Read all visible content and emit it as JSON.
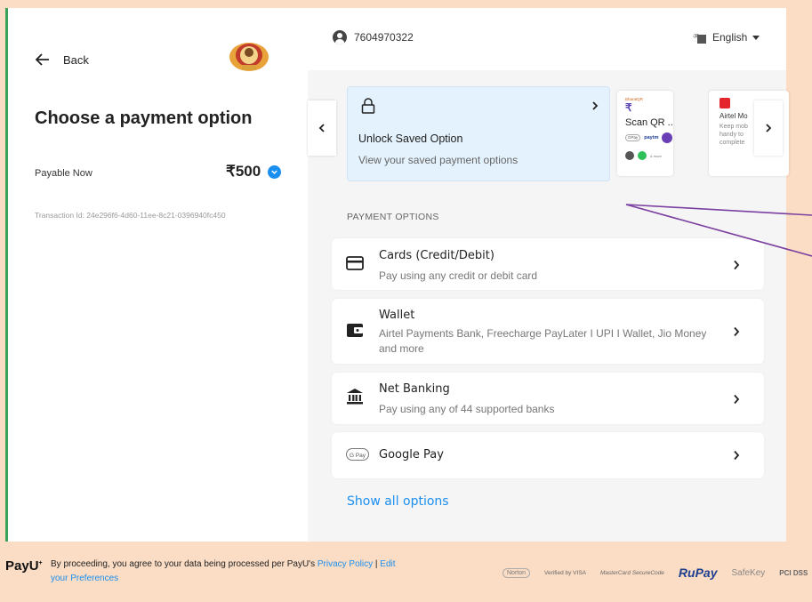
{
  "left": {
    "back_label": "Back",
    "title": "Choose a payment option",
    "payable_label": "Payable Now",
    "payable_amount": "₹500",
    "transaction": "Transaction Id: 24e296f6-4d60-11ee-8c21-0396940fc450"
  },
  "header": {
    "phone": "7604970322",
    "language": "English"
  },
  "saved": {
    "title": "Unlock Saved Option",
    "subtitle": "View your saved payment options"
  },
  "qr_card": {
    "tag": "BharatQR",
    "title": "Scan QR ...",
    "pill_label": "GPay",
    "paytm_label": "paytm",
    "extra_label": "& more"
  },
  "airtel_card": {
    "title": "Airtel Mo",
    "description": "Keep mob\nhandy to\ncomplete"
  },
  "section_label": "PAYMENT OPTIONS",
  "options": [
    {
      "title": "Cards (Credit/Debit)",
      "desc": "Pay using any credit or debit card",
      "icon": "card-icon"
    },
    {
      "title": "Wallet",
      "desc": "Airtel Payments Bank, Freecharge PayLater I UPI I Wallet, Jio Money and more",
      "icon": "wallet-icon"
    },
    {
      "title": "Net Banking",
      "desc": "Pay using any of 44 supported banks",
      "icon": "bank-icon"
    },
    {
      "title": "Google Pay",
      "desc": "",
      "icon": "gpay-icon",
      "gpay_badge": "G Pay"
    }
  ],
  "show_all": "Show all options",
  "footer": {
    "brand": "PayU",
    "text": "By proceeding, you agree to your data being processed per PayU's ",
    "privacy": "Privacy Policy",
    "separator": " | ",
    "prefs": "Edit your Preferences"
  },
  "badges": {
    "norton": "Norton",
    "visa": "Verified by VISA",
    "mastercard": "MasterCard SecureCode",
    "rupay": "RuPay",
    "safekey": "SafeKey",
    "pci": "PCI DSS"
  },
  "colors": {
    "accent": "#1a8ff0",
    "background": "#fbdcc4",
    "saved_bg": "#e4f2fd",
    "annotation": "#7a3fa0"
  }
}
